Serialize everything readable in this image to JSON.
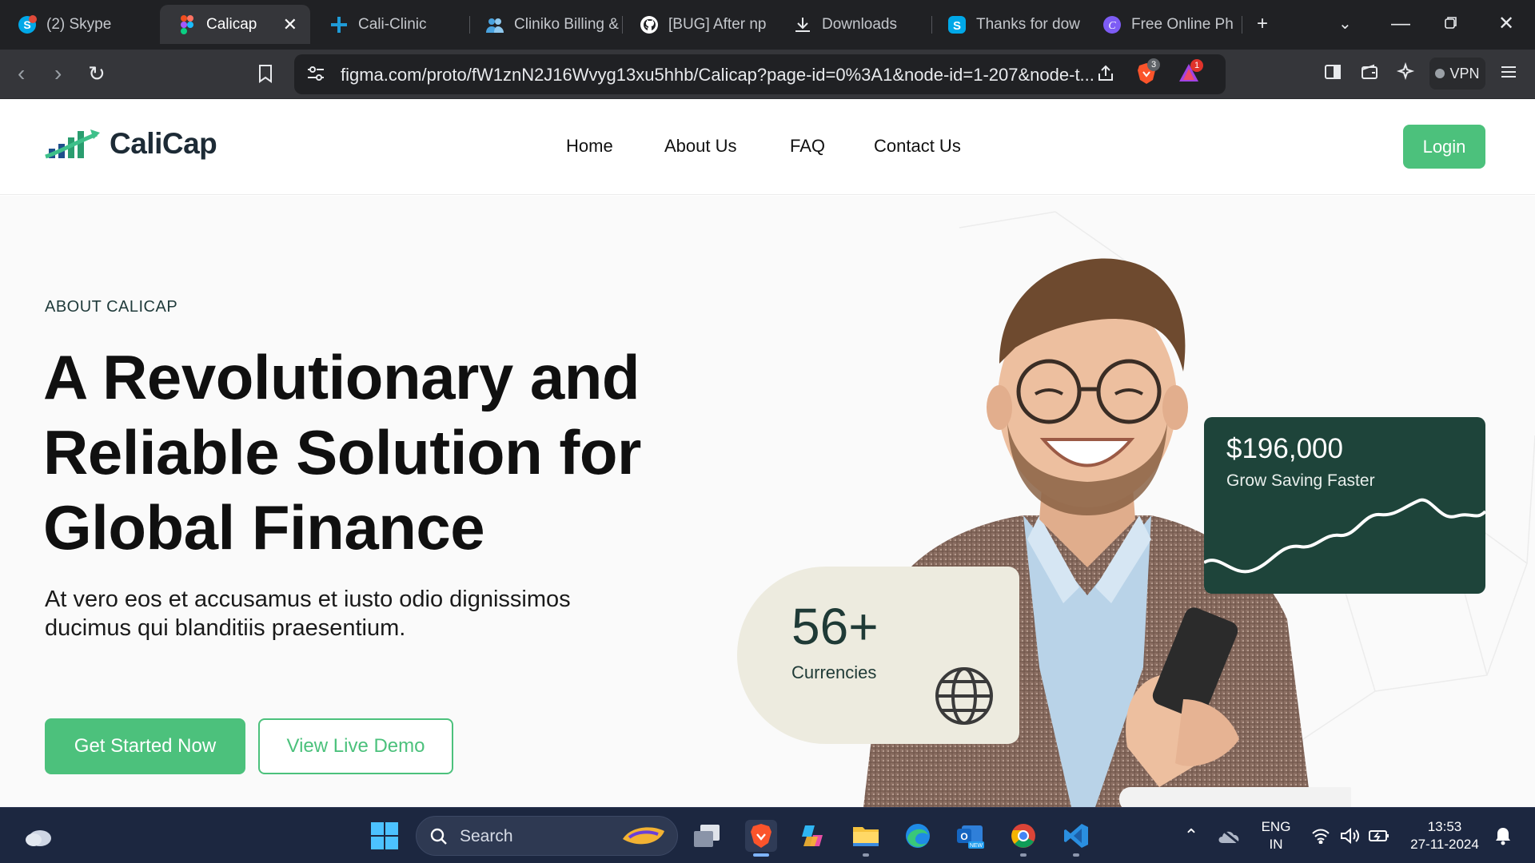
{
  "browser": {
    "tabs": [
      {
        "title": "(2) Skype",
        "icon": "skype-icon",
        "active": false
      },
      {
        "title": "Calicap",
        "icon": "figma-icon",
        "active": true
      },
      {
        "title": "Cali-Clinic",
        "icon": "cali-clinic-icon",
        "active": false
      },
      {
        "title": "Cliniko Billing &",
        "icon": "people-icon",
        "active": false
      },
      {
        "title": "[BUG] After np",
        "icon": "github-icon",
        "active": false
      },
      {
        "title": "Downloads",
        "icon": "download-icon",
        "active": false
      },
      {
        "title": "Thanks for dow",
        "icon": "skype-icon",
        "active": false
      },
      {
        "title": "Free Online Ph",
        "icon": "canva-icon",
        "active": false
      }
    ],
    "url": "figma.com/proto/fW1znN2J16Wvyg13xu5hhb/Calicap?page-id=0%3A1&node-id=1-207&node-t...",
    "brave_badge": "3",
    "alert_badge": "1",
    "vpn_label": "VPN"
  },
  "site": {
    "logo_text": "CaliCap",
    "nav": [
      "Home",
      "About Us",
      "FAQ",
      "Contact Us"
    ],
    "login_label": "Login",
    "accent_color": "#4cc17c",
    "dark_green": "#1e443a"
  },
  "hero": {
    "eyebrow": "ABOUT CALICAP",
    "title_lines": [
      "A Revolutionary and",
      "Reliable Solution for",
      "Global Finance"
    ],
    "subtitle": "At vero eos et accusamus et iusto odio dignissimos ducimus qui blanditiis praesentium.",
    "primary_cta": "Get Started Now",
    "secondary_cta": "View Live Demo",
    "currency_card": {
      "value": "56+",
      "label": "Currencies",
      "icon": "globe-icon"
    },
    "saving_card": {
      "amount": "$196,000",
      "label": "Grow Saving Faster"
    }
  },
  "taskbar": {
    "search_label": "Search",
    "language": "ENG",
    "region": "IN",
    "time": "13:53",
    "date": "27-11-2024",
    "apps": [
      "windows-start-icon",
      "task-view-icon",
      "brave-icon",
      "copilot-icon",
      "file-explorer-icon",
      "edge-icon",
      "outlook-new-icon",
      "chrome-icon",
      "vscode-icon"
    ]
  }
}
